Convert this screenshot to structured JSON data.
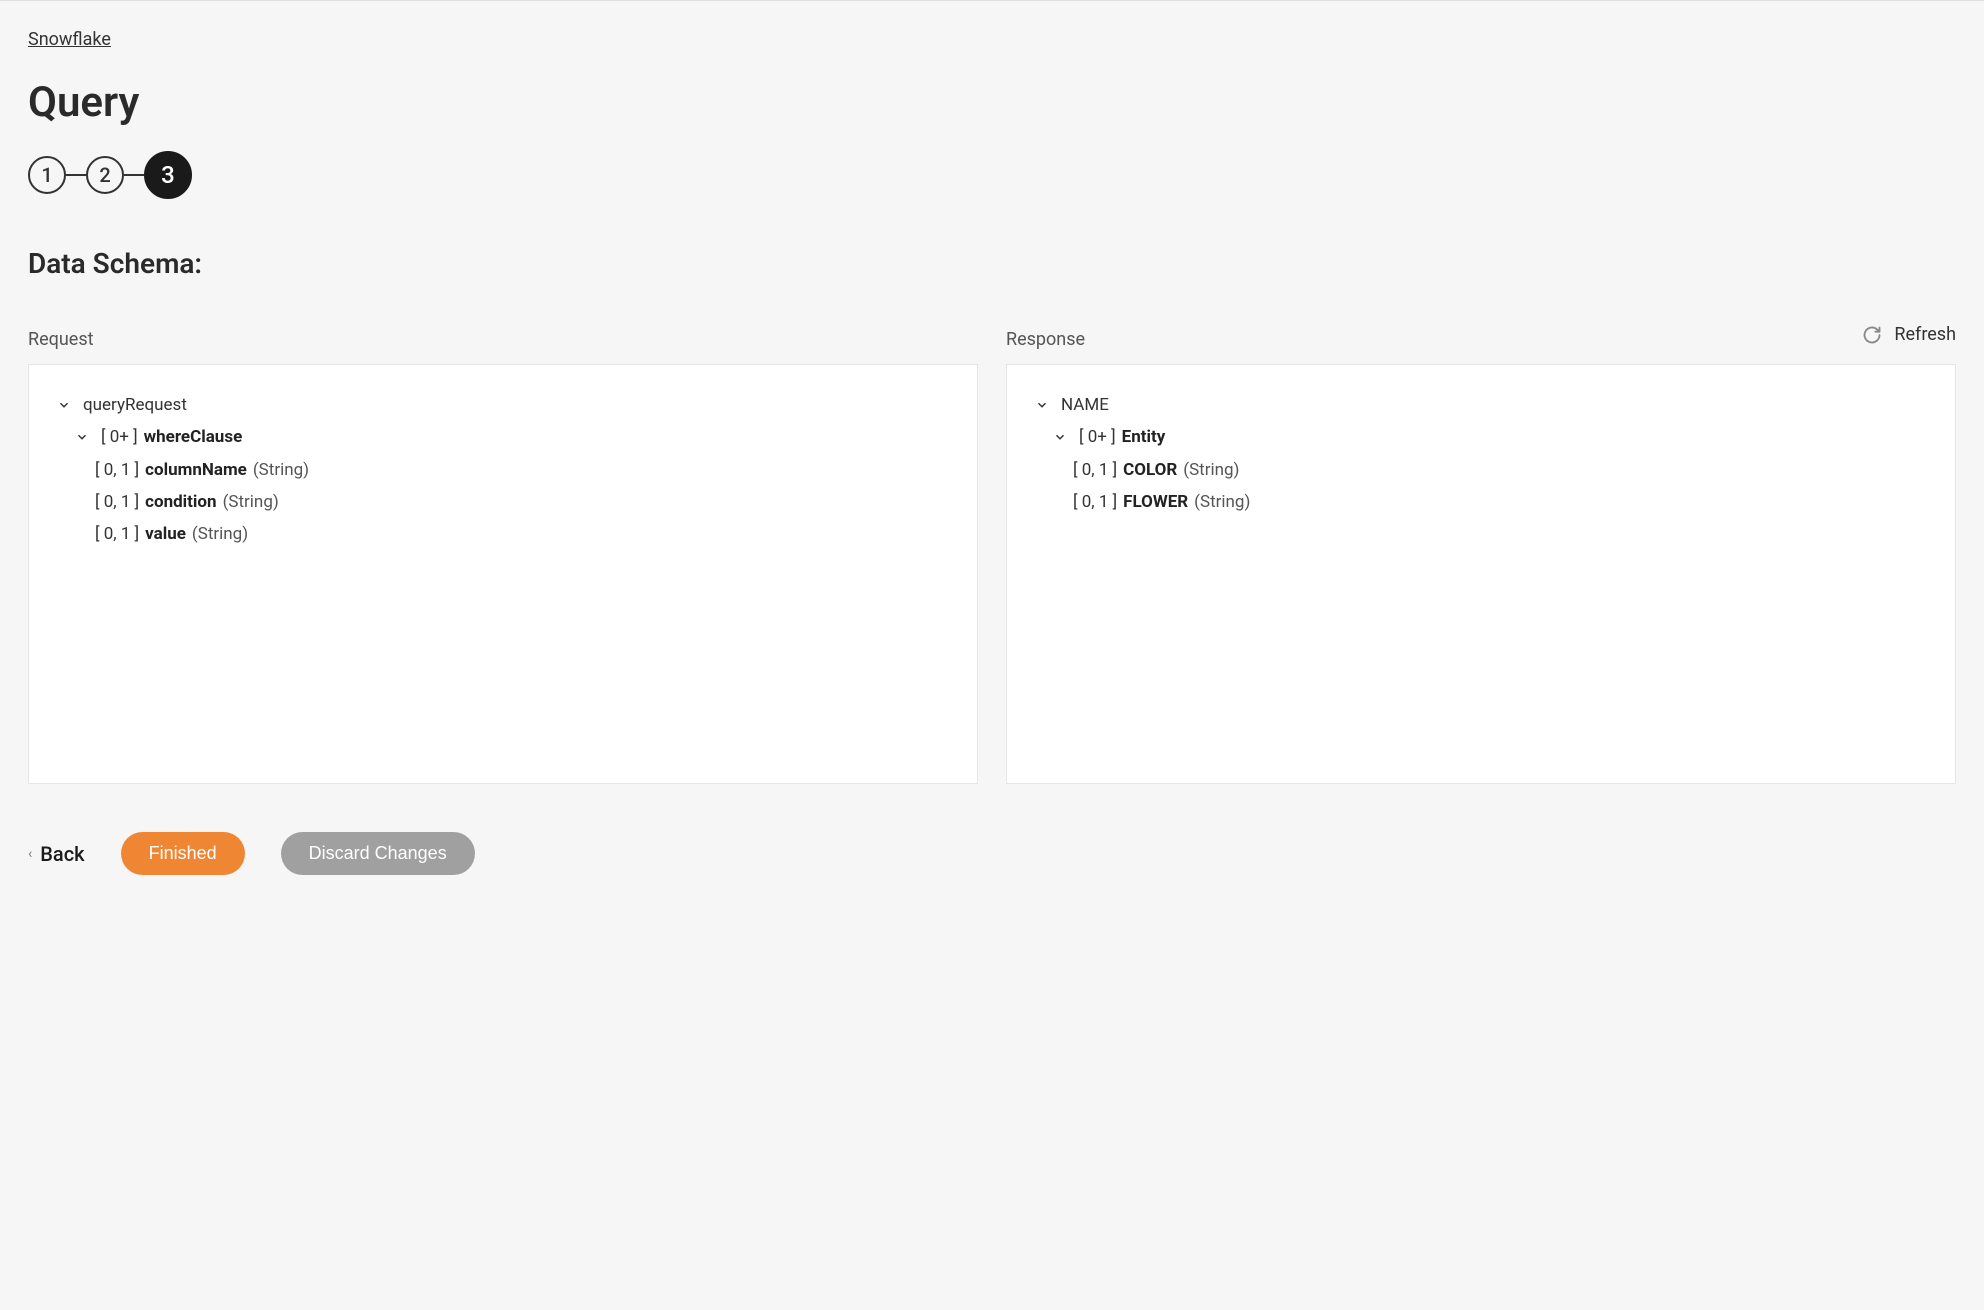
{
  "breadcrumb": {
    "label": "Snowflake"
  },
  "page": {
    "title": "Query",
    "section_heading": "Data Schema:"
  },
  "stepper": {
    "steps": [
      "1",
      "2",
      "3"
    ],
    "active_index": 2
  },
  "refresh": {
    "label": "Refresh"
  },
  "panels": {
    "request": {
      "label": "Request",
      "root": {
        "name": "queryRequest",
        "children": [
          {
            "cardinality": "[ 0+ ]",
            "name": "whereClause",
            "children": [
              {
                "cardinality": "[ 0, 1 ]",
                "name": "columnName",
                "type": "(String)"
              },
              {
                "cardinality": "[ 0, 1 ]",
                "name": "condition",
                "type": "(String)"
              },
              {
                "cardinality": "[ 0, 1 ]",
                "name": "value",
                "type": "(String)"
              }
            ]
          }
        ]
      }
    },
    "response": {
      "label": "Response",
      "root": {
        "name": "NAME",
        "children": [
          {
            "cardinality": "[ 0+ ]",
            "name": "Entity",
            "children": [
              {
                "cardinality": "[ 0, 1 ]",
                "name": "COLOR",
                "type": "(String)"
              },
              {
                "cardinality": "[ 0, 1 ]",
                "name": "FLOWER",
                "type": "(String)"
              }
            ]
          }
        ]
      }
    }
  },
  "buttons": {
    "back": "Back",
    "finished": "Finished",
    "discard": "Discard Changes"
  }
}
